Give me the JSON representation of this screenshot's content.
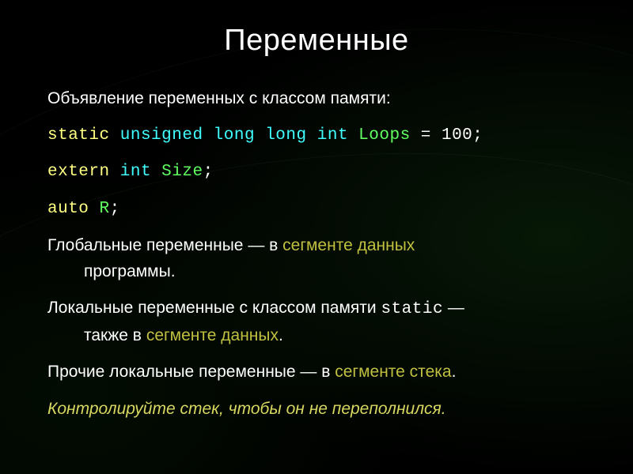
{
  "title": "Переменные",
  "intro": "Объявление переменных с классом памяти:",
  "code1": {
    "kw_static": "static",
    "kw_unsigned": "unsigned",
    "kw_long1": "long",
    "kw_long2": "long",
    "kw_int": "int",
    "ident": "Loops",
    "rest": " = 100;"
  },
  "code2": {
    "kw_extern": "extern",
    "kw_int": "int",
    "ident": "Size",
    "rest": ";"
  },
  "code3": {
    "kw_auto": "auto",
    "ident": "R",
    "rest": ";"
  },
  "para1": {
    "pre": "Глобальные переменные — в ",
    "seg": "сегменте данных",
    "post_line1": "",
    "post_line2": "программы."
  },
  "para2": {
    "pre": "Локальные переменные с классом памяти ",
    "static_kw": "static",
    "mid": " —",
    "line2_pre": "также в ",
    "seg": "сегменте данных",
    "post": "."
  },
  "para3": {
    "pre": "Прочие локальные переменные — в ",
    "seg": "сегменте стека",
    "post": "."
  },
  "note": "Контролируйте стек, чтобы он не переполнился."
}
